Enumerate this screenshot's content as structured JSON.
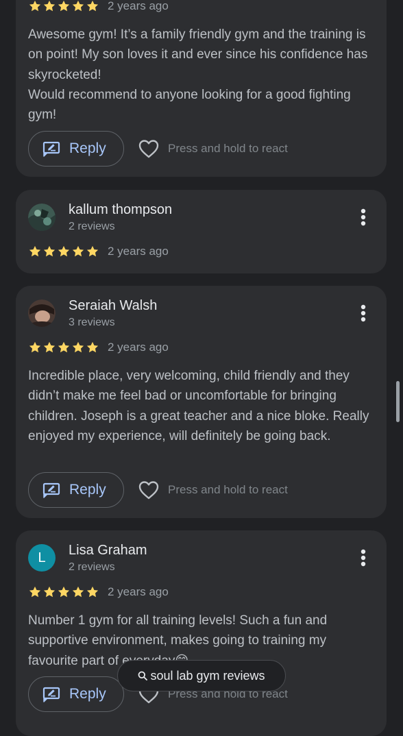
{
  "colors": {
    "background": "#202124",
    "card": "#2d2e31",
    "star": "#fdd663",
    "accent": "#a8c7fa",
    "avatar_l": "#0f8fa3"
  },
  "icons": {
    "star": "star-icon",
    "reply": "reply-icon",
    "react": "heart-icon",
    "more": "more-vert-icon",
    "search": "search-icon"
  },
  "reviews": [
    {
      "rating": 5,
      "date": "2 years ago",
      "text": "Awesome gym! It’s a family friendly gym and the training is on point! My son loves it and ever since his confidence has skyrocketed!\nWould recommend to anyone looking for a good fighting gym!",
      "reply_label": "Reply",
      "react_hint": "Press and hold to react"
    },
    {
      "name": "kallum thompson",
      "review_count": "2 reviews",
      "rating": 5,
      "date": "2 years ago"
    },
    {
      "name": "Seraiah Walsh",
      "review_count": "3 reviews",
      "rating": 5,
      "date": "2 years ago",
      "text": "Incredible place, very welcoming, child friendly and they didn’t make me feel bad or uncomfortable for bringing children. Joseph is a great teacher and a nice bloke. Really enjoyed my experience, will definitely be going back.",
      "reply_label": "Reply",
      "react_hint": "Press and hold to react"
    },
    {
      "name": "Lisa Graham",
      "avatar_letter": "L",
      "review_count": "2 reviews",
      "rating": 5,
      "date": "2 years ago",
      "text": "Number 1 gym for all training levels! Such a fun and supportive environment, makes going to training my favourite part of everyday😁",
      "reply_label": "Reply",
      "react_hint": "Press and hold to react"
    }
  ],
  "search_pill": {
    "label": "soul lab gym reviews"
  }
}
